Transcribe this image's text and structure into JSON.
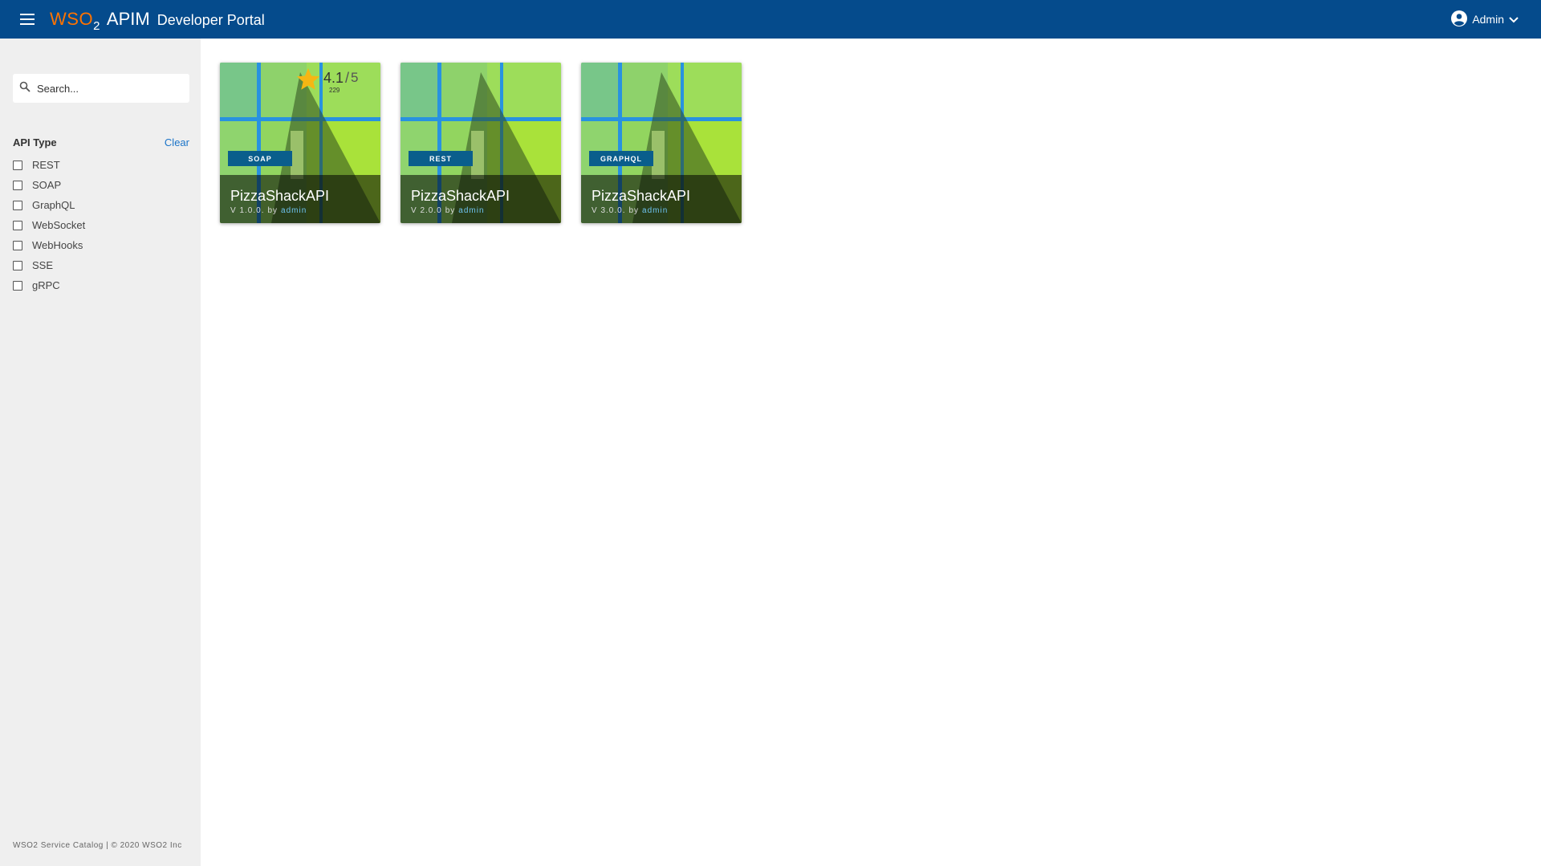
{
  "header": {
    "brand_wso": "WSO",
    "brand_two": "2",
    "brand_apim": "APIM",
    "brand_portal": "Developer Portal",
    "user_name": "Admin",
    "bg_color": "#054b8c",
    "brand_accent": "#ff7300"
  },
  "sidebar": {
    "search_placeholder": "Search...",
    "filter_title": "API Type",
    "clear_label": "Clear",
    "filters": [
      "REST",
      "SOAP",
      "GraphQL",
      "WebSocket",
      "WebHooks",
      "SSE",
      "gRPC"
    ],
    "footer": "WSO2 Service Catalog | © 2020 WSO2 Inc"
  },
  "cards": [
    {
      "name": "PizzaShackAPI",
      "type": "SOAP",
      "version": "V 1.0.0.",
      "by": "by",
      "author": "admin",
      "rating": {
        "value": "4.1",
        "sep": "/",
        "max": "5",
        "count": "229"
      }
    },
    {
      "name": "PizzaShackAPI",
      "type": "REST",
      "version": "V 2.0.0",
      "by": "by",
      "author": "admin"
    },
    {
      "name": "PizzaShackAPI",
      "type": "GRAPHQL",
      "version": "V 3.0.0.",
      "by": "by",
      "author": "admin"
    }
  ],
  "icons": {
    "menu": "hamburger-menu-icon",
    "search": "search-icon",
    "user": "account-circle-icon",
    "dropdown": "chevron-down-icon",
    "star": "star-icon"
  },
  "colors": {
    "badge": "#0a5e8c",
    "star": "#f6b613",
    "link": "#1a73c8",
    "author": "#6ec3f0"
  }
}
